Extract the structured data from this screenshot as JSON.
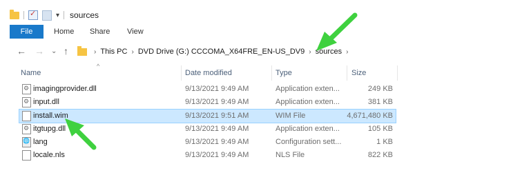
{
  "window": {
    "title": "sources"
  },
  "ribbon": {
    "tabs": [
      "File",
      "Home",
      "Share",
      "View"
    ]
  },
  "breadcrumb": [
    "This PC",
    "DVD Drive (G:) CCCOMA_X64FRE_EN-US_DV9",
    "sources"
  ],
  "columns": {
    "name": "Name",
    "date": "Date modified",
    "type": "Type",
    "size": "Size"
  },
  "files": [
    {
      "name": "imagingprovider.dll",
      "date": "9/13/2021 9:49 AM",
      "type": "Application exten...",
      "size": "249 KB",
      "icon": "dll-file-icon"
    },
    {
      "name": "input.dll",
      "date": "9/13/2021 9:49 AM",
      "type": "Application exten...",
      "size": "381 KB",
      "icon": "dll-file-icon"
    },
    {
      "name": "install.wim",
      "date": "9/13/2021 9:51 AM",
      "type": "WIM File",
      "size": "4,671,480 KB",
      "icon": "wim-file-icon",
      "selected": true
    },
    {
      "name": "itgtupg.dll",
      "date": "9/13/2021 9:49 AM",
      "type": "Application exten...",
      "size": "105 KB",
      "icon": "dll-file-icon"
    },
    {
      "name": "lang",
      "date": "9/13/2021 9:49 AM",
      "type": "Configuration sett...",
      "size": "1 KB",
      "icon": "config-file-icon"
    },
    {
      "name": "locale.nls",
      "date": "9/13/2021 9:49 AM",
      "type": "NLS File",
      "size": "822 KB",
      "icon": "nls-file-icon"
    }
  ],
  "colors": {
    "accent": "#1979ca",
    "selection": "#cce8ff",
    "annotation_arrow": "#3fd13f"
  }
}
